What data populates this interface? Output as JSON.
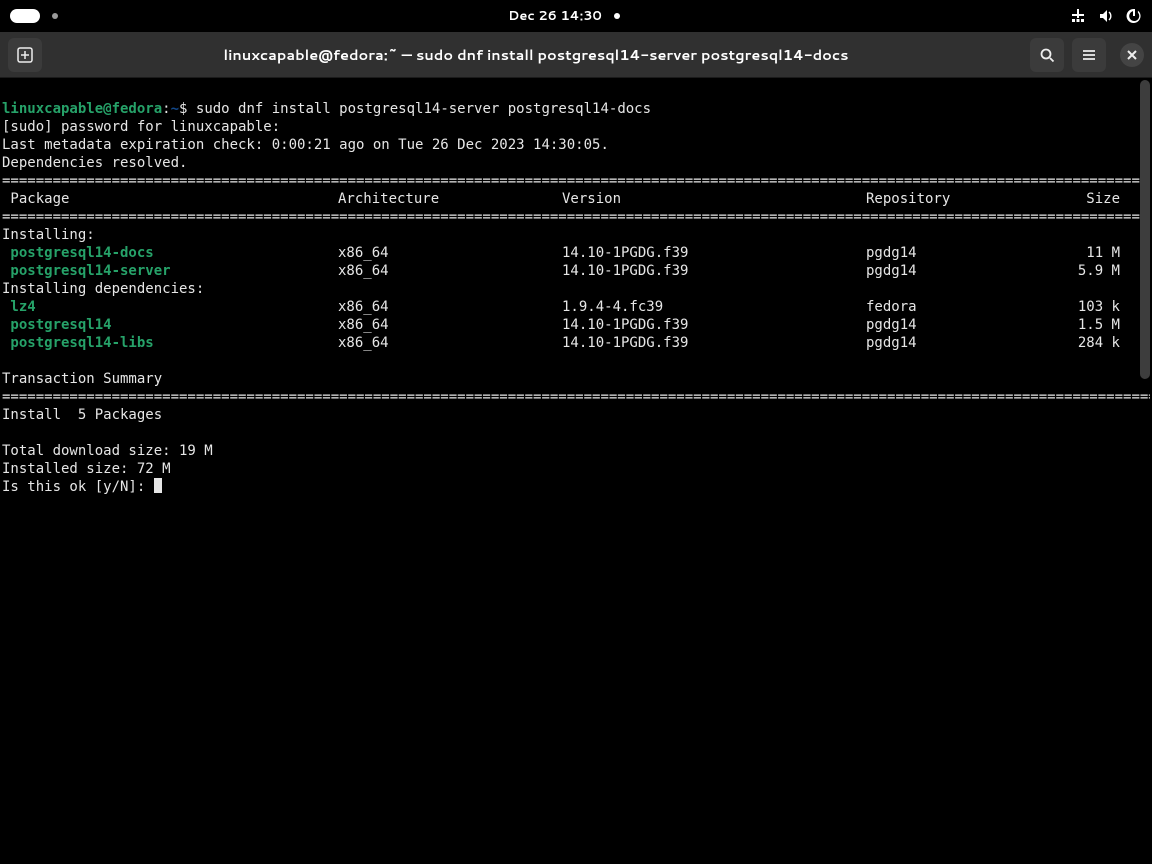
{
  "desktop": {
    "clock": "Dec 26  14:30"
  },
  "window": {
    "title": "linuxcapable@fedora:~ — sudo dnf install postgresql14-server postgresql14-docs"
  },
  "prompt": {
    "user_host": "linuxcapable@fedora",
    "sep": ":",
    "cwd": "~",
    "dollar": "$ ",
    "command": "sudo dnf install postgresql14-server postgresql14-docs"
  },
  "lines": {
    "sudo_prompt": "[sudo] password for linuxcapable:",
    "metadata": "Last metadata expiration check: 0:00:21 ago on Tue 26 Dec 2023 14:30:05.",
    "resolved": "Dependencies resolved.",
    "installing": "Installing:",
    "installing_deps": "Installing dependencies:",
    "tx_summary": "Transaction Summary",
    "install_count": "Install  5 Packages",
    "dl_size": "Total download size: 19 M",
    "inst_size": "Installed size: 72 M",
    "confirm": "Is this ok [y/N]: "
  },
  "headers": {
    "package": " Package",
    "arch": "Architecture",
    "version": "Version",
    "repo": "Repository",
    "size": "Size"
  },
  "packages": {
    "main": [
      {
        "name": " postgresql14-docs",
        "arch": "x86_64",
        "version": "14.10-1PGDG.f39",
        "repo": "pgdg14",
        "size": "11 M"
      },
      {
        "name": " postgresql14-server",
        "arch": "x86_64",
        "version": "14.10-1PGDG.f39",
        "repo": "pgdg14",
        "size": "5.9 M"
      }
    ],
    "deps": [
      {
        "name": " lz4",
        "arch": "x86_64",
        "version": "1.9.4-4.fc39",
        "repo": "fedora",
        "size": "103 k"
      },
      {
        "name": " postgresql14",
        "arch": "x86_64",
        "version": "14.10-1PGDG.f39",
        "repo": "pgdg14",
        "size": "1.5 M"
      },
      {
        "name": " postgresql14-libs",
        "arch": "x86_64",
        "version": "14.10-1PGDG.f39",
        "repo": "pgdg14",
        "size": "284 k"
      }
    ]
  }
}
